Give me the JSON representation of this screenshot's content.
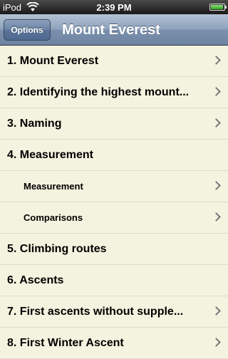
{
  "status_bar": {
    "carrier": "iPod",
    "time": "2:39 PM",
    "battery_level": 0.95,
    "battery_color": "#2fa11e"
  },
  "nav_bar": {
    "title": "Mount Everest",
    "options_label": "Options",
    "bar_color": "#8da1bb"
  },
  "list": {
    "items": [
      {
        "label": "1. Mount Everest",
        "has_chevron": true,
        "indented": false
      },
      {
        "label": "2. Identifying the highest mount...",
        "has_chevron": true,
        "indented": false
      },
      {
        "label": "3. Naming",
        "has_chevron": true,
        "indented": false
      },
      {
        "label": "4. Measurement",
        "has_chevron": false,
        "indented": false
      },
      {
        "label": "Measurement",
        "has_chevron": true,
        "indented": true
      },
      {
        "label": "Comparisons",
        "has_chevron": true,
        "indented": true
      },
      {
        "label": "5. Climbing routes",
        "has_chevron": false,
        "indented": false
      },
      {
        "label": "6. Ascents",
        "has_chevron": false,
        "indented": false
      },
      {
        "label": "7. First ascents without supple...",
        "has_chevron": true,
        "indented": false
      },
      {
        "label": "8. First Winter Ascent",
        "has_chevron": true,
        "indented": false
      }
    ]
  }
}
